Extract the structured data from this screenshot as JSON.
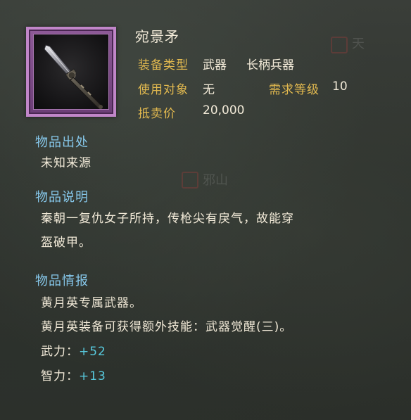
{
  "item": {
    "name": "宛景矛",
    "icon": "spear-icon",
    "rarity_color": "#c186c9"
  },
  "stats": {
    "type_label": "装备类型",
    "type_value": "武器",
    "subtype_value": "长柄兵器",
    "user_label": "使用对象",
    "user_value": "无",
    "level_label": "需求等级",
    "level_value": "10",
    "price_label": "抵卖价",
    "price_value": "20,000"
  },
  "origin": {
    "title": "物品出处",
    "text": "未知来源"
  },
  "description": {
    "title": "物品说明",
    "lines": [
      "秦朝一复仇女子所持，传枪尖有戾气，故能穿",
      "盔破甲。"
    ]
  },
  "intel": {
    "title": "物品情报",
    "lines": [
      "黄月英专属武器。",
      "黄月英装备可获得额外技能：武器觉醒(三)。"
    ],
    "attrs": [
      {
        "label": "武力：",
        "value": "+52"
      },
      {
        "label": "智力：",
        "value": "+13"
      }
    ]
  },
  "background_marks": {
    "top_right": "天",
    "middle": "邪山"
  },
  "colors": {
    "label": "#e2b94f",
    "section_title": "#86c7ea",
    "attr_value": "#57c9dd",
    "text": "#f2ead8"
  }
}
